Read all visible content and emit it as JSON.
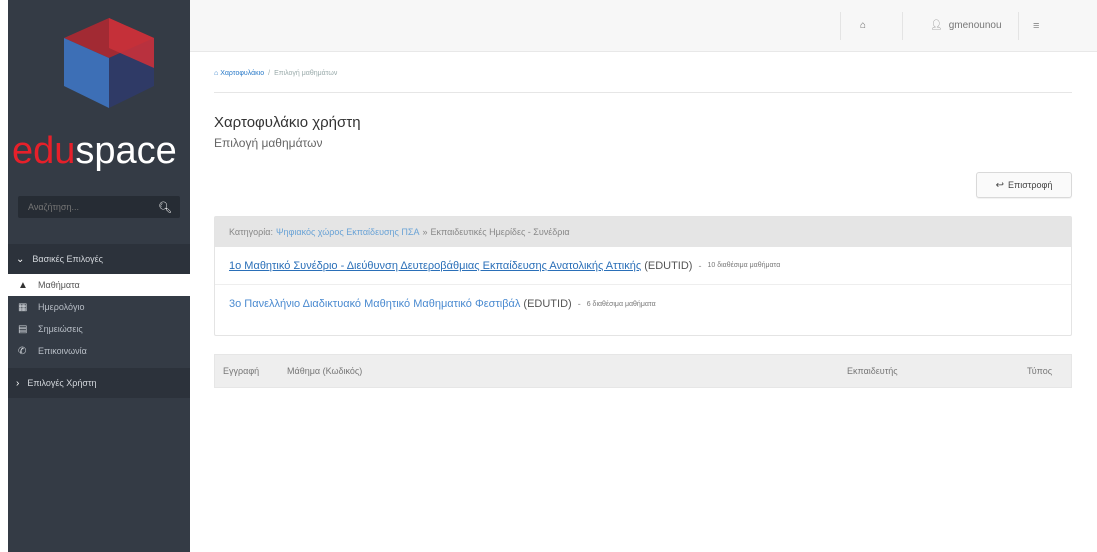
{
  "sidebar": {
    "logo_part1": "edu",
    "logo_part2": "space",
    "search_placeholder": "Αναζήτηση...",
    "section1": "Βασικές Επιλογές",
    "items": [
      {
        "label": "Μαθήματα",
        "icon": "graduation-cap-icon",
        "glyph": "🎓"
      },
      {
        "label": "Ημερολόγιο",
        "icon": "calendar-icon",
        "glyph": "▦"
      },
      {
        "label": "Σημειώσεις",
        "icon": "notes-icon",
        "glyph": "▤"
      },
      {
        "label": "Επικοινωνία",
        "icon": "phone-icon",
        "glyph": "✆"
      }
    ],
    "section2": "Επιλογές Χρήστη"
  },
  "topbar": {
    "username": "gmenounou"
  },
  "breadcrumb": {
    "home": "Χαρτοφυλάκιο",
    "separator": "/",
    "current": "Επιλογή μαθημάτων"
  },
  "page": {
    "title": "Χαρτοφυλάκιο χρήστη",
    "subtitle": "Επιλογή μαθημάτων",
    "back_label": "Επιστροφή"
  },
  "category": {
    "label": "Κατηγορία:",
    "link": "Ψηφιακός χώρος Εκπαίδευσης ΠΣΑ",
    "separator": "»",
    "current": "Εκπαιδευτικές Ημερίδες - Συνέδρια"
  },
  "courses": [
    {
      "title": "1ο Μαθητικό Συνέδριο - Διεύθυνση Δευτεροβάθμιας Εκπαίδευσης Ανατολικής Αττικής",
      "code": "(EDUTID)",
      "count": "10 διαθέσιμα μαθήματα"
    },
    {
      "title": "3ο Πανελλήνιο Διαδικτυακό Μαθητικό Μαθηματικό Φεστιβάλ",
      "code": "(EDUTID)",
      "count": "6 διαθέσιμα μαθήματα"
    }
  ],
  "table": {
    "col_register": "Εγγραφή",
    "col_course": "Μάθημα (Κωδικός)",
    "col_teacher": "Εκπαιδευτής",
    "col_type": "Τύπος"
  },
  "colors": {
    "sidebar": "#343b45",
    "brand_red": "#e6202a",
    "link_blue": "#2a6fb8"
  }
}
